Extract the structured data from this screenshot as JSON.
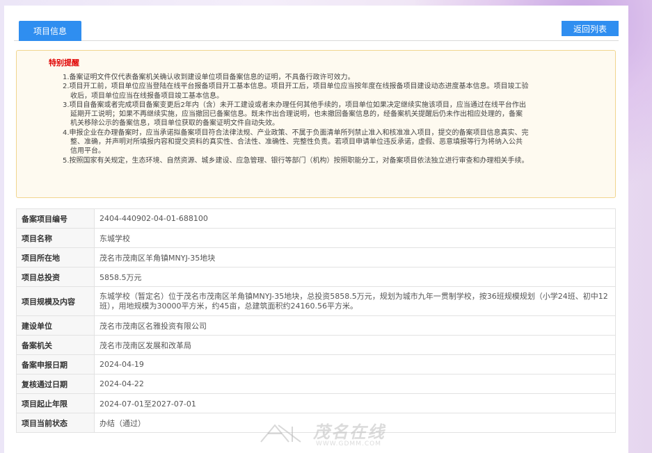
{
  "tabs": [
    {
      "label": "项目信息",
      "active": true
    }
  ],
  "back_button": "返回列表",
  "notice": {
    "title": "特别提醒",
    "items": [
      "1.备案证明文件仅代表备案机关确认收到建设单位项目备案信息的证明，不具备行政许可效力。",
      "2.项目开工前，项目单位应当登陆在线平台报备项目开工基本信息。项目开工后，项目单位应当按年度在线报备项目建设动态进度基本信息。项目竣工验收后，项目单位应当在线报备项目竣工基本信息。",
      "3.项目自备案或者完成项目备案变更后2年内（含）未开工建设或者未办理任何其他手续的，项目单位如果决定继续实施该项目，应当通过在线平台作出延期开工说明；如果不再继续实施，应当撤回已备案信息。既未作出合理说明，也未撤回备案信息的，经备案机关提醒后仍未作出相应处理的，备案机关移除公示的备案信息，项目单位获取的备案证明文件自动失效。",
      "4.申报企业在办理备案时，应当承诺拟备案项目符合法律法规、产业政策、不属于负面清单所列禁止准入和核准准入项目，提交的备案项目信息真实、完整、准确，并声明对所填报内容和提交资料的真实性、合法性、准确性、完整性负责。若项目申请单位违反承诺，虚假、恶意填报等行为将纳入公共信用平台。",
      "5.按照国家有关规定，生态环境、自然资源、城乡建设、应急管理、银行等部门（机构）按照职能分工，对备案项目依法独立进行审查和办理相关手续。"
    ]
  },
  "info_rows": [
    {
      "label": "备案项目编号",
      "value": "2404-440902-04-01-688100"
    },
    {
      "label": "项目名称",
      "value": "东城学校"
    },
    {
      "label": "项目所在地",
      "value": "茂名市茂南区羊角镇MNYJ-35地块"
    },
    {
      "label": "项目总投资",
      "value": "5858.5万元"
    },
    {
      "label": "项目规模及内容",
      "value": "东城学校（暂定名）位于茂名市茂南区羊角镇MNYJ-35地块，总投资5858.5万元，规划为城市九年一贯制学校，按36班规模规划（小学24班、初中12班），用地规模为30000平方米，约45亩，总建筑面积约24160.56平方米。"
    },
    {
      "label": "建设单位",
      "value": "茂名市茂南区名雅投资有限公司"
    },
    {
      "label": "备案机关",
      "value": "茂名市茂南区发展和改革局"
    },
    {
      "label": "备案申报日期",
      "value": "2024-04-19"
    },
    {
      "label": "复核通过日期",
      "value": "2024-04-22"
    },
    {
      "label": "项目起止年限",
      "value": "2024-07-01至2027-07-01"
    },
    {
      "label": "项目当前状态",
      "value": "办结（通过）"
    }
  ],
  "watermark": {
    "text": "茂名在线",
    "url": "WWW.GDMM.COM"
  }
}
